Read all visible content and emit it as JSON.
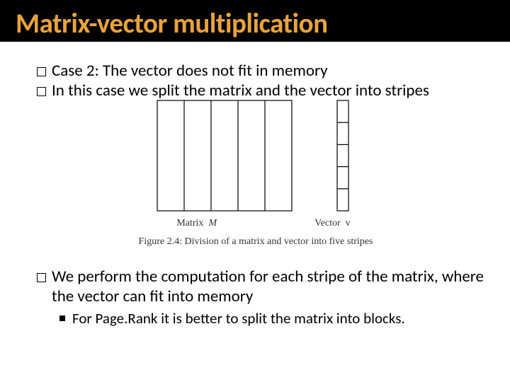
{
  "title": "Matrix-vector multiplication",
  "bullets": {
    "b1": "Case 2: The vector does not fit in memory",
    "b2": "In this case we split the matrix and the vector into stripes",
    "b3": "We perform the computation for each stripe of the matrix, where the vector can fit into memory",
    "sub1": "For Page.Rank it is better to split the matrix into blocks."
  },
  "figure": {
    "matrix_label": "Matrix",
    "matrix_symbol": "M",
    "vector_label": "Vector",
    "vector_symbol": "v",
    "caption": "Figure 2.4: Division of a matrix and vector into five stripes",
    "stripes": 5
  }
}
